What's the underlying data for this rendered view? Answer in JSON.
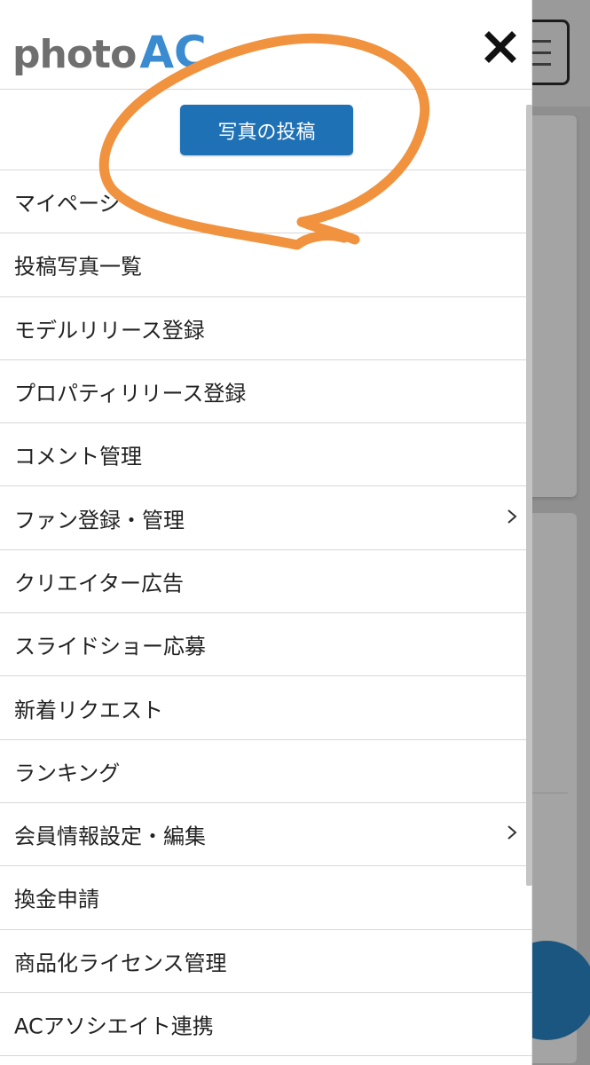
{
  "logo": {
    "part1": "photo",
    "part2": "AC",
    "colors": {
      "photo": "#6f6f6f",
      "ac": "#3a8bd0"
    }
  },
  "header": {
    "close_icon": "close-icon"
  },
  "post_button": {
    "label": "写真の投稿",
    "color": "#1f71b6"
  },
  "menu": {
    "items": [
      {
        "label": "マイページ",
        "has_submenu": false
      },
      {
        "label": "投稿写真一覧",
        "has_submenu": false
      },
      {
        "label": "モデルリリース登録",
        "has_submenu": false
      },
      {
        "label": "プロパティリリース登録",
        "has_submenu": false
      },
      {
        "label": "コメント管理",
        "has_submenu": false
      },
      {
        "label": "ファン登録・管理",
        "has_submenu": true
      },
      {
        "label": "クリエイター広告",
        "has_submenu": false
      },
      {
        "label": "スライドショー応募",
        "has_submenu": false
      },
      {
        "label": "新着リクエスト",
        "has_submenu": false
      },
      {
        "label": "ランキング",
        "has_submenu": false
      },
      {
        "label": "会員情報設定・編集",
        "has_submenu": true
      },
      {
        "label": "換金申請",
        "has_submenu": false
      },
      {
        "label": "商品化ライセンス管理",
        "has_submenu": false
      },
      {
        "label": "ACアソシエイト連携",
        "has_submenu": false
      }
    ]
  },
  "annotation_color": "#f0923e"
}
